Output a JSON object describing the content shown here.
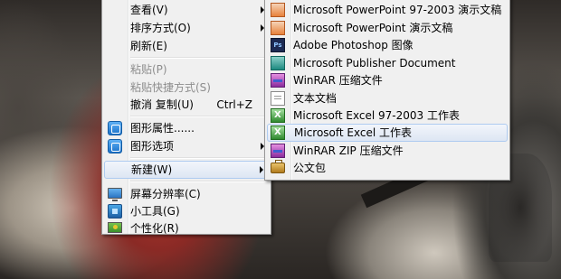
{
  "context_menu": {
    "items": [
      {
        "label": "查看(V)",
        "has_submenu": true
      },
      {
        "label": "排序方式(O)",
        "has_submenu": true
      },
      {
        "label": "刷新(E)"
      },
      {
        "label": "粘贴(P)",
        "disabled": true
      },
      {
        "label": "粘贴快捷方式(S)",
        "disabled": true
      },
      {
        "label": "撤消 复制(U)",
        "shortcut": "Ctrl+Z"
      },
      {
        "label": "图形属性......",
        "icon": "graphics-icon"
      },
      {
        "label": "图形选项",
        "icon": "graphics-icon",
        "has_submenu": true
      },
      {
        "label": "新建(W)",
        "has_submenu": true,
        "highlighted": true
      },
      {
        "label": "屏幕分辨率(C)",
        "icon": "monitor-icon"
      },
      {
        "label": "小工具(G)",
        "icon": "gadget-icon"
      },
      {
        "label": "个性化(R)",
        "icon": "personalize-icon"
      }
    ]
  },
  "new_submenu": {
    "items": [
      {
        "label": "Microsoft PowerPoint 97-2003 演示文稿",
        "icon": "powerpoint-icon"
      },
      {
        "label": "Microsoft PowerPoint 演示文稿",
        "icon": "powerpoint-icon"
      },
      {
        "label": "Adobe Photoshop 图像",
        "icon": "photoshop-icon",
        "icon_text": "Ps"
      },
      {
        "label": "Microsoft Publisher Document",
        "icon": "publisher-icon"
      },
      {
        "label": "WinRAR 压缩文件",
        "icon": "winrar-icon"
      },
      {
        "label": "文本文档",
        "icon": "text-document-icon"
      },
      {
        "label": "Microsoft Excel 97-2003 工作表",
        "icon": "excel-icon"
      },
      {
        "label": "Microsoft Excel 工作表",
        "icon": "excel-icon",
        "highlighted": true
      },
      {
        "label": "WinRAR ZIP 压缩文件",
        "icon": "winrar-zip-icon"
      },
      {
        "label": "公文包",
        "icon": "briefcase-icon"
      }
    ]
  },
  "colors": {
    "menu_background": "#f0f0f0",
    "highlight_border": "#aecbf0",
    "disabled_text": "#8d8d8d"
  }
}
